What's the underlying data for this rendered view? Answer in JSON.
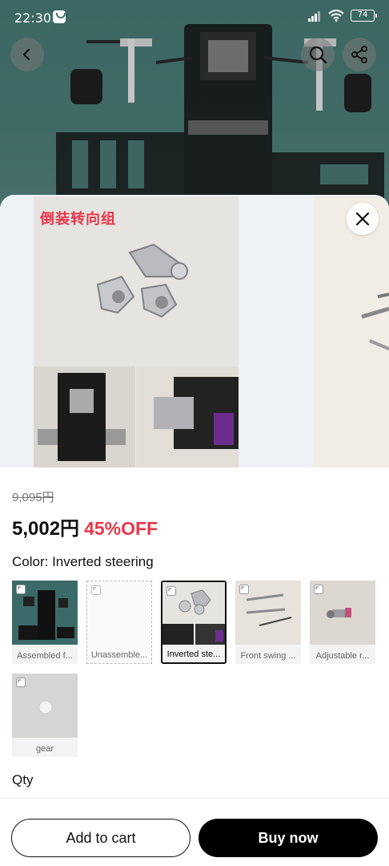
{
  "status_bar": {
    "time": "22:30",
    "battery": "74"
  },
  "gallery": {
    "image_label": "倒装转向组"
  },
  "pricing": {
    "original_price": "9,095円",
    "price": "5,002円",
    "discount": "45%OFF"
  },
  "color": {
    "label": "Color: Inverted steering"
  },
  "variants": [
    {
      "label": "Assembled  f...",
      "style": "normal"
    },
    {
      "label": "Unassemble...",
      "style": "dashed"
    },
    {
      "label": "Inverted ste...",
      "style": "selected"
    },
    {
      "label": "Front swing ...",
      "style": "normal"
    },
    {
      "label": "Adjustable r...",
      "style": "normal"
    },
    {
      "label": "gear",
      "style": "normal"
    }
  ],
  "quantity": {
    "label": "Qty"
  },
  "actions": {
    "add_to_cart": "Add to cart",
    "buy_now": "Buy now"
  },
  "colors": {
    "accent": "#e8384a",
    "dark": "#000000",
    "backdrop": "#3f6563"
  },
  "icons": [
    "back-icon",
    "search-icon",
    "share-icon",
    "close-icon",
    "expand-icon"
  ]
}
